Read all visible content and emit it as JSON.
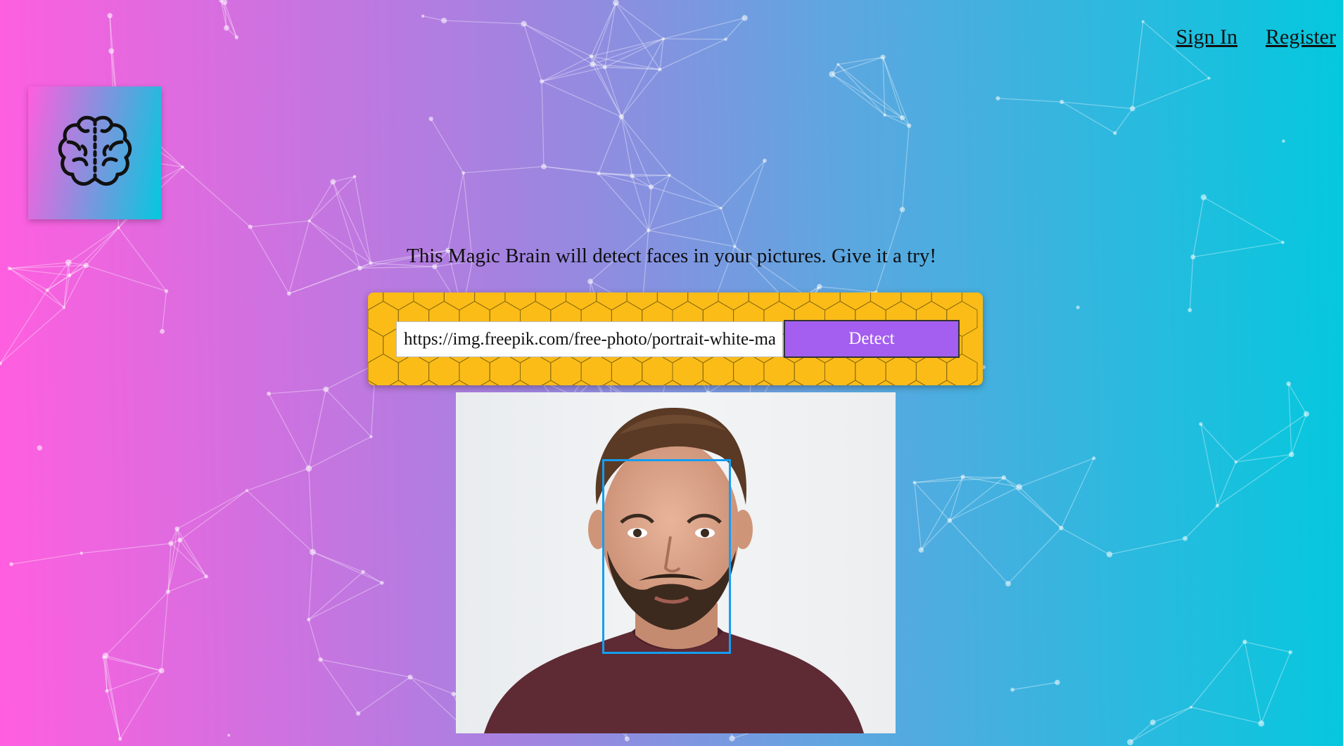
{
  "nav": {
    "sign_in": "Sign In",
    "register": "Register"
  },
  "logo": {
    "icon": "brain-icon"
  },
  "tagline": "This Magic Brain will detect faces in your pictures. Give it a try!",
  "form": {
    "input_value": "https://img.freepik.com/free-photo/portrait-white-man",
    "detect_label": "Detect"
  },
  "result": {
    "image": "portrait-photo",
    "face_box_color": "#149df2"
  },
  "colors": {
    "gradient_start": "#ff5edf",
    "gradient_end": "#04c8de",
    "form_bg": "#fbbc17",
    "button_bg": "#a45ef0"
  }
}
